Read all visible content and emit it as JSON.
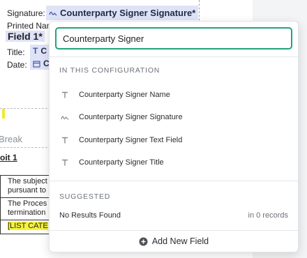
{
  "document": {
    "signature_label": "Signature:",
    "signature_chip": "Counterparty Signer Signature*",
    "printed_name_label": "Printed Nam",
    "field1_label": "Field 1*",
    "title_label": "Title:",
    "title_chip": "C",
    "date_label": "Date:",
    "date_chip": "C",
    "page_break_text": "Break",
    "exhibit_heading": "oit 1",
    "table_rows": [
      {
        "line1": "The subject",
        "line2": "pursuant to"
      },
      {
        "line1": "The Proces",
        "line2": "termination"
      },
      {
        "line1": "[LIST CATE",
        "line2": ""
      }
    ]
  },
  "popover": {
    "search": {
      "value": "Counterparty Signer"
    },
    "section_config": "IN THIS CONFIGURATION",
    "options": [
      {
        "label": "Counterparty Signer Name",
        "icon": "text-type-icon"
      },
      {
        "label": "Counterparty Signer Signature",
        "icon": "signature-icon"
      },
      {
        "label": "Counterparty Signer Text Field",
        "icon": "text-type-icon"
      },
      {
        "label": "Counterparty Signer Title",
        "icon": "text-type-icon"
      }
    ],
    "section_suggested": "SUGGESTED",
    "no_results": "No Results Found",
    "records": "in 0 records",
    "add_new_field": "Add New Field"
  },
  "colors": {
    "accent_green": "#21a37a",
    "chip_blue": "#dfe3f7",
    "highlight_yellow": "#f6f23a"
  }
}
